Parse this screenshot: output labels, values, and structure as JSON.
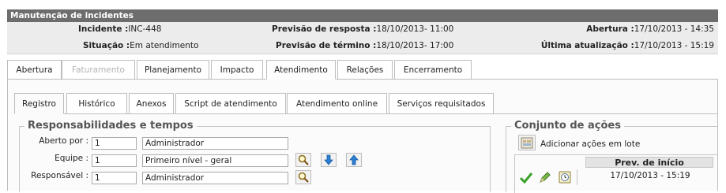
{
  "window": {
    "title": "Manutenção de incidentes"
  },
  "info": {
    "incidente_label": "Incidente :",
    "incidente_value": "INC-448",
    "situacao_label": "Situação :",
    "situacao_value": "Em atendimento",
    "prev_resposta_label": "Previsão de resposta :",
    "prev_resposta_value": "18/10/2013- 11:00",
    "prev_termino_label": "Previsão de término :",
    "prev_termino_value": "18/10/2013- 17:00",
    "abertura_label": "Abertura :",
    "abertura_value": "17/10/2013 - 14:35",
    "ultima_label": "Última atualização :",
    "ultima_value": "17/10/2013 - 15:19"
  },
  "main_tabs": [
    {
      "label": "Abertura"
    },
    {
      "label": "Faturamento"
    },
    {
      "label": "Planejamento"
    },
    {
      "label": "Impacto"
    },
    {
      "label": "Atendimento"
    },
    {
      "label": "Relações"
    },
    {
      "label": "Encerramento"
    }
  ],
  "sub_tabs": [
    {
      "label": "Registro"
    },
    {
      "label": "Histórico"
    },
    {
      "label": "Anexos"
    },
    {
      "label": "Script de atendimento"
    },
    {
      "label": "Atendimento online"
    },
    {
      "label": "Serviços requisitados"
    }
  ],
  "responsabilidades": {
    "legend": "Responsabilidades e tempos",
    "aberto_por_label": "Aberto por :",
    "aberto_por_code": "1",
    "aberto_por_name": "Administrador",
    "equipe_label": "Equipe :",
    "equipe_code": "1",
    "equipe_name": "Primeiro nível - geral",
    "responsavel_label": "Responsável :",
    "responsavel_code": "1",
    "responsavel_name": "Administrador"
  },
  "acoes": {
    "legend": "Conjunto de ações",
    "add_batch_label": "Adicionar ações em lote",
    "grid_header": "Prev. de início",
    "row_value": "17/10/2013 - 15:19"
  },
  "colors": {
    "titlebar": "#6d6d6d",
    "info_bg": "#ececec",
    "border": "#bdbdbd",
    "icon_blue": "#2a7fd4",
    "icon_green": "#3aa02a"
  }
}
